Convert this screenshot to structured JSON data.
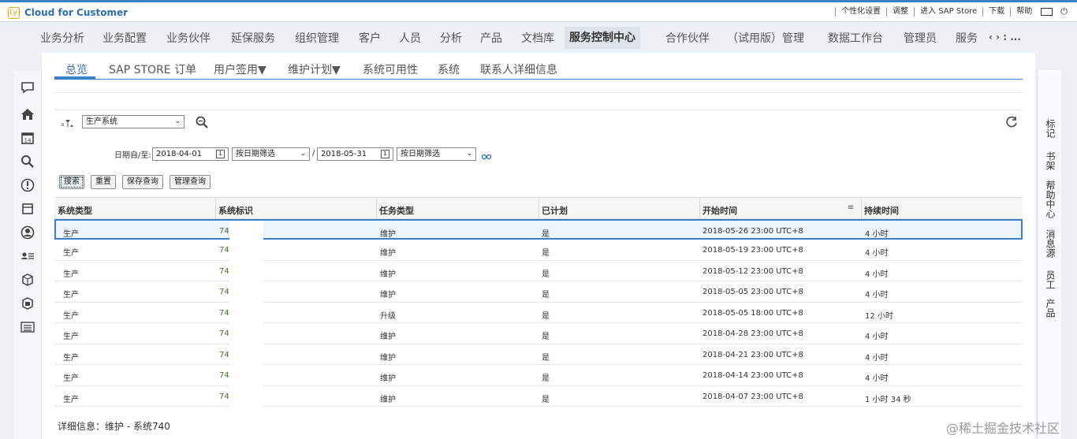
{
  "header": {
    "app_title": "Cloud for Customer",
    "logo_glyph": "{y}",
    "links": [
      "个性化设置",
      "调整",
      "进入 SAP Store",
      "下载",
      "帮助"
    ],
    "power_glyph": "⏻"
  },
  "mainnav": {
    "items": [
      "业务分析",
      "业务配置",
      "业务伙伴",
      "延保服务",
      "组织管理",
      "客户",
      "人员",
      "分析",
      "产品",
      "文档库",
      "服务控制中心",
      "合作伙伴",
      "（试用版）管理",
      "数据工作台",
      "管理员",
      "服务"
    ],
    "active": "服务控制中心",
    "scroll_glyph": "‹ › : ..."
  },
  "subtabs": {
    "items": [
      "总览",
      "SAP STORE 订单",
      "用户签用▼",
      "维护计划▼",
      "系统可用性",
      "系统",
      "联系人详细信息"
    ],
    "active": "总览"
  },
  "toolbar": {
    "view_select": "生产系统"
  },
  "filter": {
    "date_label": "日期自/至:",
    "from_date": "2018-04-01",
    "from_mode": "按日期筛选",
    "separator": "/",
    "to_date": "2018-05-31",
    "to_mode": "按日期筛选"
  },
  "buttons": {
    "search": "搜索",
    "reset": "重置",
    "save_query": "保存查询",
    "manage_query": "管理查询"
  },
  "table": {
    "columns": [
      "系统类型",
      "系统标识",
      "任务类型",
      "已计划",
      "开始时间",
      "持续时间"
    ],
    "rows": [
      [
        "生产",
        "74",
        "维护",
        "是",
        "2018-05-26 23:00 UTC+8",
        "4 小时"
      ],
      [
        "生产",
        "74",
        "维护",
        "是",
        "2018-05-19 23:00 UTC+8",
        "4 小时"
      ],
      [
        "生产",
        "74",
        "维护",
        "是",
        "2018-05-12 23:00 UTC+8",
        "4 小时"
      ],
      [
        "生产",
        "74",
        "维护",
        "是",
        "2018-05-05 23:00 UTC+8",
        "4 小时"
      ],
      [
        "生产",
        "74",
        "升级",
        "是",
        "2018-05-05 18:00 UTC+8",
        "12 小时"
      ],
      [
        "生产",
        "74",
        "维护",
        "是",
        "2018-04-28 23:00 UTC+8",
        "4 小时"
      ],
      [
        "生产",
        "74",
        "维护",
        "是",
        "2018-04-21 23:00 UTC+8",
        "4 小时"
      ],
      [
        "生产",
        "74",
        "维护",
        "是",
        "2018-04-14 23:00 UTC+8",
        "4 小时"
      ],
      [
        "生产",
        "74",
        "维护",
        "是",
        "2018-04-07 23:00 UTC+8",
        "1 小时 34 秒"
      ]
    ]
  },
  "detail": {
    "text": "详细信息：维护 - 系统740"
  },
  "right_sidebar": [
    "标记",
    "书架",
    "帮助中心",
    "消息源",
    "员工",
    "产品"
  ],
  "watermark": "@稀土掘金技术社区",
  "colors": {
    "accent": "#3a7fc8",
    "title": "#2f6db5",
    "selected_row": "#eef4fb"
  }
}
